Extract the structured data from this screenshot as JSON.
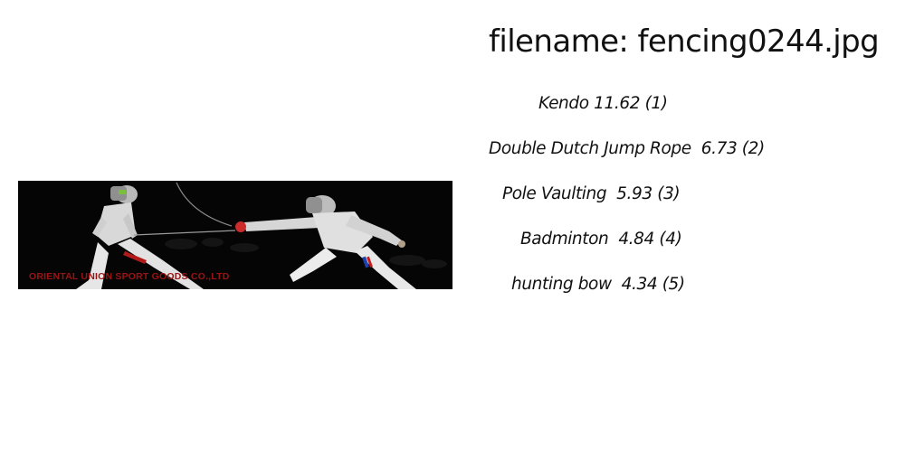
{
  "title": "filename: fencing0244.jpg",
  "image": {
    "watermark": "ORIENTAL UNION SPORT GOODS CO.,LTD"
  },
  "predictions": [
    {
      "label": "Kendo",
      "score": "11.62",
      "rank": "(1)",
      "text": "Kendo 11.62 (1)"
    },
    {
      "label": "Double Dutch Jump Rope",
      "score": "6.73",
      "rank": "(2)",
      "text": "Double Dutch Jump Rope  6.73 (2)"
    },
    {
      "label": "Pole Vaulting",
      "score": "5.93",
      "rank": "(3)",
      "text": "Pole Vaulting  5.93 (3)"
    },
    {
      "label": "Badminton",
      "score": "4.84",
      "rank": "(4)",
      "text": "Badminton  4.84 (4)"
    },
    {
      "label": "hunting bow",
      "score": "4.34",
      "rank": "(5)",
      "text": "hunting bow  4.34 (5)"
    }
  ]
}
